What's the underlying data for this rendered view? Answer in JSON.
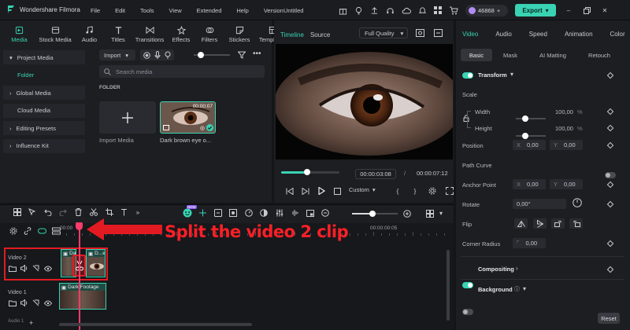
{
  "app": {
    "name": "Wondershare Filmora",
    "project": "Untitled",
    "credits": "46868",
    "export_label": "Export"
  },
  "menu": [
    "File",
    "Edit",
    "Tools",
    "View",
    "Extended",
    "Help",
    "Version"
  ],
  "media_tabs": [
    {
      "label": "Media",
      "icon": "media-icon",
      "active": true
    },
    {
      "label": "Stock Media",
      "icon": "stock-media-icon"
    },
    {
      "label": "Audio",
      "icon": "music-note-icon"
    },
    {
      "label": "Titles",
      "icon": "text-icon"
    },
    {
      "label": "Transitions",
      "icon": "transition-icon"
    },
    {
      "label": "Effects",
      "icon": "effects-icon"
    },
    {
      "label": "Filters",
      "icon": "filter-icon"
    },
    {
      "label": "Stickers",
      "icon": "sticker-icon"
    },
    {
      "label": "Templates",
      "icon": "template-icon"
    }
  ],
  "sidebar": {
    "project_media": "Project Media",
    "folder": "Folder",
    "global_media": "Global Media",
    "cloud_media": "Cloud Media",
    "editing_presets": "Editing Presets",
    "influence_kit": "Influence Kit"
  },
  "media": {
    "import_label": "Import",
    "search_placeholder": "Search media",
    "folder_label": "FOLDER",
    "import_media_label": "Import Media",
    "clip_name": "Dark brown eye o...",
    "clip_duration": "00:00:07"
  },
  "player": {
    "tab_timeline": "Timeline",
    "tab_source": "Source",
    "quality": "Full Quality",
    "current_time": "00:00:03:08",
    "separator": "/",
    "duration": "00:00:07:12",
    "custom_label": "Custom",
    "progress": 0.45
  },
  "props": {
    "tabs": [
      "Video",
      "Audio",
      "Speed",
      "Animation",
      "Color"
    ],
    "subtabs": [
      "Basic",
      "Mask",
      "AI Matting",
      "Retouch"
    ],
    "transform": "Transform",
    "scale": "Scale",
    "width": "Width",
    "width_value": "100,00",
    "height": "Height",
    "height_value": "100,00",
    "percent": "%",
    "position": "Position",
    "pos_x": "0,00",
    "pos_y": "0,00",
    "axis_x": "X",
    "axis_y": "Y",
    "path_curve": "Path Curve",
    "anchor_point": "Anchor Point",
    "anchor_x": "0,00",
    "anchor_y": "0,00",
    "rotate": "Rotate",
    "rotate_value": "0,00°",
    "flip": "Flip",
    "corner_radius": "Corner Radius",
    "corner_value": "0,00",
    "compositing": "Compositing",
    "background": "Background",
    "reset": "Reset"
  },
  "timeline": {
    "ruler_start": "00:00",
    "ruler_mark": "00:00:00:05",
    "track_video2": "Video 2",
    "track_video1": "Video 1",
    "track_audio1": "Audio 1",
    "clip_v2a": "Da",
    "clip_v2b": "D...e",
    "clip_v1": "Dark Footage",
    "annotation": "Split the video 2 clip",
    "badge": "NEW"
  },
  "colors": {
    "accent": "#39d3b3",
    "annotation": "#ff1f27",
    "playhead": "#ff3b6a"
  }
}
